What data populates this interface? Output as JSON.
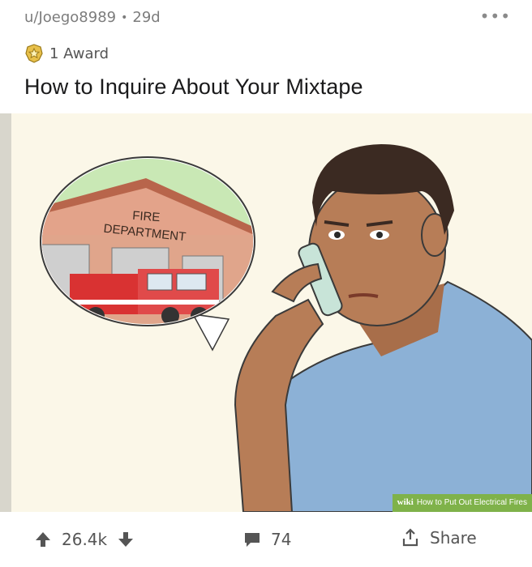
{
  "post": {
    "author": "u/Joego8989",
    "age": "29d",
    "more_label": "•••",
    "award_text": "1 Award",
    "title": "How to Inquire About Your Mixtape"
  },
  "image": {
    "sign_line1": "FIRE",
    "sign_line2": "DEPARTMENT",
    "watermark_brand": "wiki",
    "watermark_caption": "How to Put Out Electrical Fires"
  },
  "actions": {
    "upvotes": "26.4k",
    "comments": "74",
    "share_label": "Share"
  },
  "colors": {
    "background": "#fbf7e8",
    "shirt": "#8cb1d6",
    "skin": "#b77d57",
    "hair": "#3b2a22",
    "truck": "#d93232",
    "watermark": "#7fb24a"
  }
}
